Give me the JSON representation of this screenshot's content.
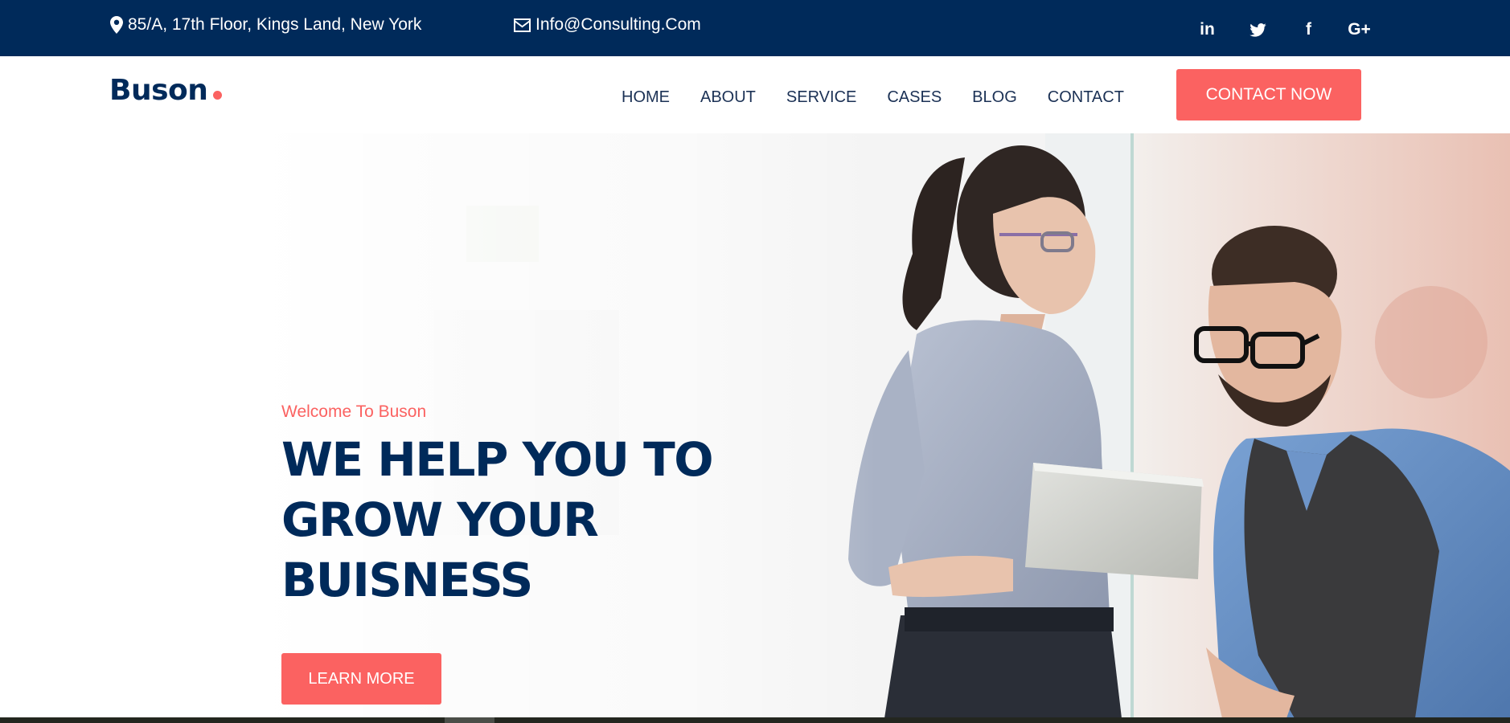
{
  "topbar": {
    "address": "85/A, 17th Floor, Kings Land, New York",
    "email": "Info@Consulting.Com",
    "social": [
      {
        "name": "linkedin-icon",
        "glyph": "in"
      },
      {
        "name": "twitter-icon",
        "glyph": ""
      },
      {
        "name": "facebook-icon",
        "glyph": "f"
      },
      {
        "name": "google-plus-icon",
        "glyph": "G+"
      }
    ]
  },
  "header": {
    "logo": "Buson",
    "nav": [
      "HOME",
      "ABOUT",
      "SERVICE",
      "CASES",
      "BLOG",
      "CONTACT"
    ],
    "cta_label": "CONTACT NOW"
  },
  "hero": {
    "welcome": "Welcome To Buson",
    "headline_lines": [
      "WE HELP YOU TO",
      "GROW YOUR",
      "BUISNESS"
    ],
    "button_label": "LEARN MORE"
  },
  "colors": {
    "navy": "#002a5a",
    "accent": "#fb6261",
    "nav_text": "#1b3155"
  }
}
